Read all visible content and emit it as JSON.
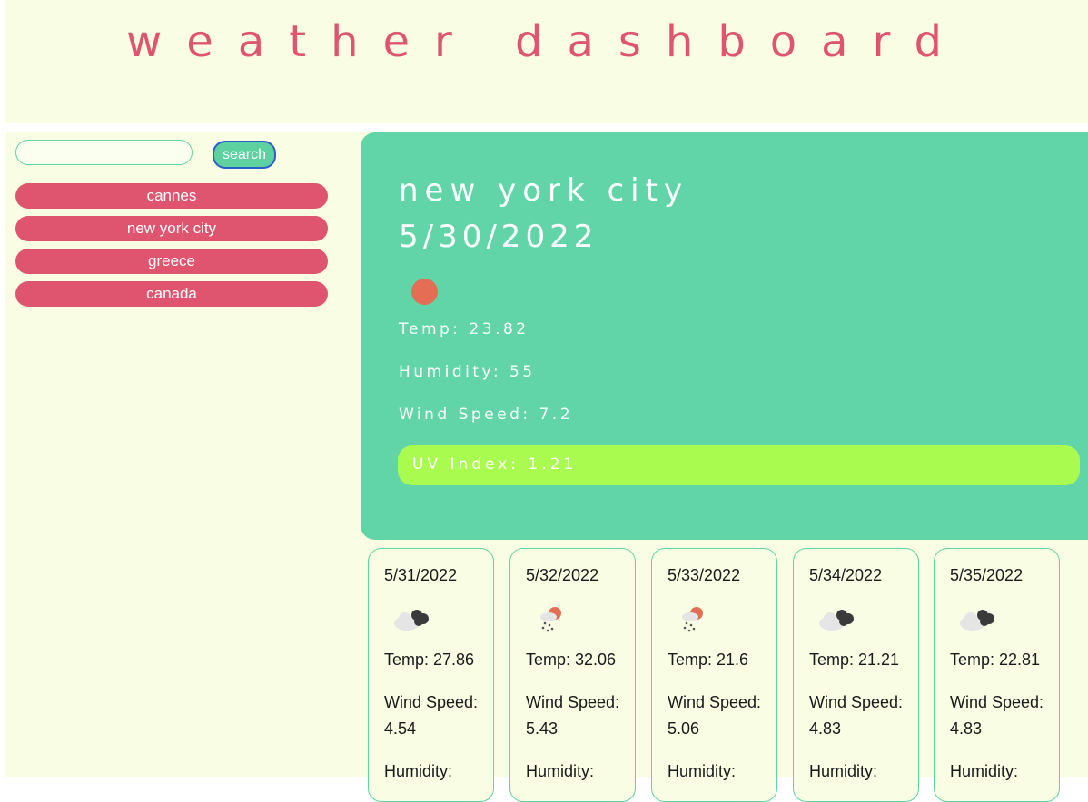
{
  "header": {
    "title": "weather dashboard"
  },
  "search": {
    "value": "",
    "button_label": "search"
  },
  "history": [
    {
      "label": "cannes"
    },
    {
      "label": "new york city"
    },
    {
      "label": "greece"
    },
    {
      "label": "canada"
    }
  ],
  "current": {
    "city": "new york city",
    "date": "5/30/2022",
    "icon": "sun-icon",
    "temp": "Temp: 23.82",
    "humidity": "Humidity: 55",
    "wind": "Wind Speed: 7.2",
    "uv": "UV Index: 1.21"
  },
  "forecast": [
    {
      "date": "5/31/2022",
      "icon": "cloud-icon",
      "temp": "Temp: 27.86",
      "wind": "Wind Speed: 4.54",
      "humidity": "Humidity:"
    },
    {
      "date": "5/32/2022",
      "icon": "rain-sun-icon",
      "temp": "Temp: 32.06",
      "wind": "Wind Speed: 5.43",
      "humidity": "Humidity:"
    },
    {
      "date": "5/33/2022",
      "icon": "rain-sun-icon",
      "temp": "Temp: 21.6",
      "wind": "Wind Speed: 5.06",
      "humidity": "Humidity:"
    },
    {
      "date": "5/34/2022",
      "icon": "cloud-icon",
      "temp": "Temp: 21.21",
      "wind": "Wind Speed: 4.83",
      "humidity": "Humidity:"
    },
    {
      "date": "5/35/2022",
      "icon": "cloud-icon",
      "temp": "Temp: 22.81",
      "wind": "Wind Speed: 4.83",
      "humidity": "Humidity:"
    }
  ],
  "colors": {
    "background": "#f8fde4",
    "accent_pink": "#df5570",
    "panel_green": "#61d5a7",
    "uv_green": "#a9fb4f",
    "sun": "#e36e55"
  }
}
